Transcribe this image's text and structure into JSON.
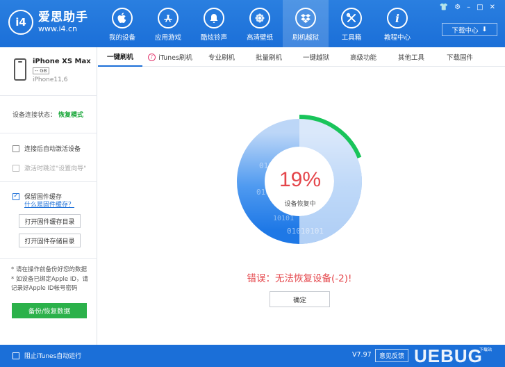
{
  "app": {
    "name": "爱思助手",
    "url": "www.i4.cn",
    "logo_text": "i4"
  },
  "nav": [
    {
      "label": "我的设备",
      "icon": "apple-icon",
      "glyph": ""
    },
    {
      "label": "应用游戏",
      "icon": "app-store-icon",
      "glyph": "A"
    },
    {
      "label": "酷炫铃声",
      "icon": "bell-icon",
      "glyph": "🔔"
    },
    {
      "label": "高清壁纸",
      "icon": "flower-icon",
      "glyph": "✿"
    },
    {
      "label": "刷机越狱",
      "icon": "dropbox-icon",
      "glyph": "◈"
    },
    {
      "label": "工具箱",
      "icon": "tools-icon",
      "glyph": "✕"
    },
    {
      "label": "教程中心",
      "icon": "info-icon",
      "glyph": "i"
    }
  ],
  "window_controls": [
    "👕",
    "⚙",
    "–",
    "□",
    "✕"
  ],
  "download_center": {
    "label": "下载中心",
    "icon": "download-icon",
    "glyph": "⬇"
  },
  "device": {
    "name": "iPhone XS Max",
    "capacity": "-- GB",
    "model": "iPhone11,6"
  },
  "status": {
    "label": "设备连接状态：",
    "value": "恢复模式"
  },
  "options": [
    {
      "label": "连接后自动激活设备",
      "checked": false,
      "disabled": false
    },
    {
      "label": "激活时跳过\"设置向导\"",
      "checked": false,
      "disabled": true
    }
  ],
  "cache": {
    "label": "保留固件缓存",
    "checked": true,
    "link": "什么是固件缓存？",
    "open_cache_btn": "打开固件缓存目录",
    "open_store_btn": "打开固件存储目录"
  },
  "tips": [
    "* 请在操作前备份好您的数据",
    "* 如设备已绑定Apple ID，请记录好Apple ID帐号密码"
  ],
  "backup_btn": "备份/恢复数据",
  "tabs": [
    {
      "label": "一键刷机",
      "active": true
    },
    {
      "label": "iTunes刷机",
      "active": false,
      "icon": "itunes-icon"
    },
    {
      "label": "专业刷机",
      "active": false
    },
    {
      "label": "批量刷机",
      "active": false
    },
    {
      "label": "一键越狱",
      "active": false
    },
    {
      "label": "高级功能",
      "active": false
    },
    {
      "label": "其他工具",
      "active": false
    },
    {
      "label": "下载固件",
      "active": false
    }
  ],
  "progress": {
    "percent_text": "19%",
    "percent": 19,
    "label": "设备恢复中",
    "binary_text": [
      "0101",
      "0101",
      "10101",
      "01010101"
    ]
  },
  "error": "错误：无法恢复设备(-2)!",
  "confirm_btn": "确定",
  "footer": {
    "itunes_block": "阻止iTunes自动运行",
    "version": "V7.97",
    "feedback": "意见反馈",
    "watermark": "UEBUG",
    "watermark_sub": "下载站"
  },
  "colors": {
    "primary": "#1b6fd8",
    "green": "#2bb14a",
    "error": "#e4454a",
    "ring_inner": "#3b8ef0",
    "ring_outer": "#cfe2fb",
    "progress_arc": "#19c45a"
  }
}
